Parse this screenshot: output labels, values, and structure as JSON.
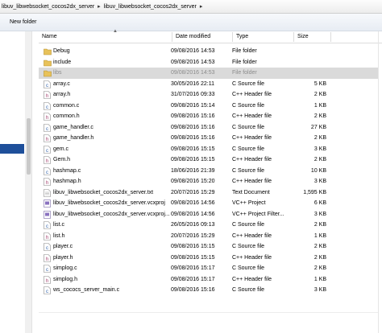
{
  "breadcrumb": [
    "libuv_libwebsocket_cocos2dx_server",
    "libuv_libwebsocket_cocos2dx_server"
  ],
  "toolbar": {
    "new_folder": "New folder"
  },
  "columns": {
    "name": "Name",
    "date": "Date modified",
    "type": "Type",
    "size": "Size"
  },
  "files": [
    {
      "name": "Debug",
      "date": "09/08/2016 14:53",
      "type": "File folder",
      "size": "",
      "icon": "folder-icon"
    },
    {
      "name": "include",
      "date": "09/08/2016 14:53",
      "type": "File folder",
      "size": "",
      "icon": "folder-icon"
    },
    {
      "name": "libs",
      "date": "09/08/2016 14:53",
      "type": "File folder",
      "size": "",
      "icon": "folder-icon",
      "selected": true
    },
    {
      "name": "array.c",
      "date": "30/05/2016 22:11",
      "type": "C Source file",
      "size": "5 KB",
      "icon": "c-source-icon"
    },
    {
      "name": "array.h",
      "date": "31/07/2016 09:33",
      "type": "C++ Header file",
      "size": "2 KB",
      "icon": "header-icon"
    },
    {
      "name": "common.c",
      "date": "09/08/2016 15:14",
      "type": "C Source file",
      "size": "1 KB",
      "icon": "c-source-icon"
    },
    {
      "name": "common.h",
      "date": "09/08/2016 15:16",
      "type": "C++ Header file",
      "size": "2 KB",
      "icon": "header-icon"
    },
    {
      "name": "game_handler.c",
      "date": "09/08/2016 15:16",
      "type": "C Source file",
      "size": "27 KB",
      "icon": "c-source-icon"
    },
    {
      "name": "game_handler.h",
      "date": "09/08/2016 15:16",
      "type": "C++ Header file",
      "size": "2 KB",
      "icon": "header-icon"
    },
    {
      "name": "gem.c",
      "date": "09/08/2016 15:15",
      "type": "C Source file",
      "size": "3 KB",
      "icon": "c-source-icon"
    },
    {
      "name": "Gem.h",
      "date": "09/08/2016 15:15",
      "type": "C++ Header file",
      "size": "2 KB",
      "icon": "header-icon"
    },
    {
      "name": "hashmap.c",
      "date": "18/06/2016 21:39",
      "type": "C Source file",
      "size": "10 KB",
      "icon": "c-source-icon"
    },
    {
      "name": "hashmap.h",
      "date": "09/08/2016 15:20",
      "type": "C++ Header file",
      "size": "3 KB",
      "icon": "header-icon"
    },
    {
      "name": "libuv_libwebsocket_cocos2dx_server.txt",
      "date": "20/07/2016 15:29",
      "type": "Text Document",
      "size": "1,595 KB",
      "icon": "text-document-icon"
    },
    {
      "name": "libuv_libwebsocket_cocos2dx_server.vcxproj",
      "date": "09/08/2016 14:56",
      "type": "VC++ Project",
      "size": "6 KB",
      "icon": "vcxproj-icon"
    },
    {
      "name": "libuv_libwebsocket_cocos2dx_server.vcxproj...",
      "date": "09/08/2016 14:56",
      "type": "VC++ Project Filter...",
      "size": "3 KB",
      "icon": "vcxproj-filter-icon"
    },
    {
      "name": "list.c",
      "date": "26/05/2016 09:13",
      "type": "C Source file",
      "size": "2 KB",
      "icon": "c-source-icon"
    },
    {
      "name": "list.h",
      "date": "20/07/2016 15:29",
      "type": "C++ Header file",
      "size": "1 KB",
      "icon": "header-icon"
    },
    {
      "name": "player.c",
      "date": "09/08/2016 15:15",
      "type": "C Source file",
      "size": "2 KB",
      "icon": "c-source-icon"
    },
    {
      "name": "player.h",
      "date": "09/08/2016 15:15",
      "type": "C++ Header file",
      "size": "2 KB",
      "icon": "header-icon"
    },
    {
      "name": "simplog.c",
      "date": "09/08/2016 15:17",
      "type": "C Source file",
      "size": "2 KB",
      "icon": "c-source-icon"
    },
    {
      "name": "simplog.h",
      "date": "09/08/2016 15:17",
      "type": "C++ Header file",
      "size": "1 KB",
      "icon": "header-icon"
    },
    {
      "name": "ws_cococs_server_main.c",
      "date": "09/08/2016 15:16",
      "type": "C Source file",
      "size": "3 KB",
      "icon": "c-source-icon"
    }
  ],
  "colors": {
    "selected_row": "#dadada",
    "nav_selection": "#1e4f9a",
    "folder": "#e8c25a",
    "c_source": "#2a5ca8",
    "header": "#a03a6a"
  }
}
